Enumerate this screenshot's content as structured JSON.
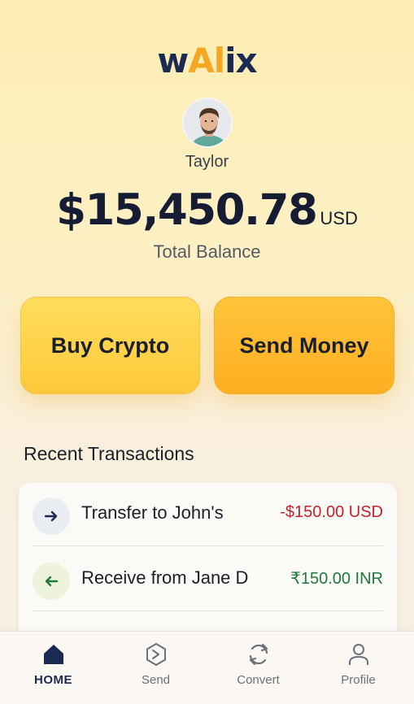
{
  "app": {
    "logo_prefix": "w",
    "logo_accent": "Al",
    "logo_suffix": "ix"
  },
  "user": {
    "name": "Taylor"
  },
  "balance": {
    "amount": "$15,450.78",
    "currency": "USD",
    "caption": "Total Balance"
  },
  "actions": {
    "buy_label": "Buy Crypto",
    "send_label": "Send Money"
  },
  "transactions": {
    "title": "Recent Transactions",
    "items": [
      {
        "label": "Transfer to John's",
        "amount": "-$150.00 USD",
        "direction": "out",
        "icon": "arrow-right-icon"
      },
      {
        "label": "Receive from Jane D",
        "amount": "₹150.00 INR",
        "direction": "in",
        "icon": "arrow-left-icon"
      }
    ]
  },
  "nav": {
    "items": [
      {
        "label": "HOME",
        "icon": "home-icon",
        "active": true
      },
      {
        "label": "Send",
        "icon": "send-icon",
        "active": false
      },
      {
        "label": "Convert",
        "icon": "convert-icon",
        "active": false
      },
      {
        "label": "Profile",
        "icon": "profile-icon",
        "active": false
      }
    ]
  },
  "colors": {
    "brand_navy": "#1b2a52",
    "brand_orange": "#f5a623",
    "negative": "#c4232a",
    "positive": "#20793a"
  }
}
